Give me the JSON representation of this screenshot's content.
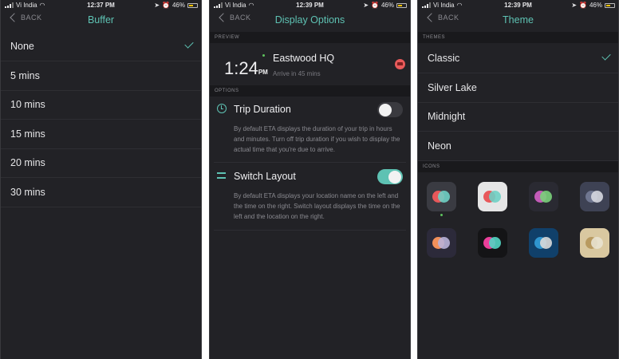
{
  "screens": [
    {
      "status": {
        "carrier": "Vi India",
        "time": "12:37 PM",
        "battery": "46%"
      },
      "nav": {
        "back": "BACK",
        "title": "Buffer"
      },
      "options": [
        "None",
        "5 mins",
        "10 mins",
        "15 mins",
        "20 mins",
        "30 mins"
      ],
      "selected": "None"
    },
    {
      "status": {
        "carrier": "Vi India",
        "time": "12:39 PM",
        "battery": "46%"
      },
      "nav": {
        "back": "BACK",
        "title": "Display Options"
      },
      "preview_header": "PREVIEW",
      "preview": {
        "time": "1:24",
        "ampm": "PM",
        "name": "Eastwood HQ",
        "subtitle": "Arrive in 45 mins"
      },
      "options_header": "OPTIONS",
      "trip_duration": {
        "title": "Trip Duration",
        "description": "By default ETA displays the duration of your trip in hours and minutes. Turn off trip duration if you wish to display the actual time that you're due to arrive.",
        "enabled": false
      },
      "switch_layout": {
        "title": "Switch Layout",
        "description": "By default ETA displays your location name on the left and the time on the right. Switch layout displays the time on the left and the location on the right.",
        "enabled": true
      }
    },
    {
      "status": {
        "carrier": "Vi India",
        "time": "12:39 PM",
        "battery": "46%"
      },
      "nav": {
        "back": "BACK",
        "title": "Theme"
      },
      "themes_header": "THEMES",
      "themes": [
        "Classic",
        "Silver Lake",
        "Midnight",
        "Neon"
      ],
      "selected": "Classic",
      "icons_header": "ICONS",
      "icons": [
        {
          "bg": "#3a3b42",
          "a": "#e8585a",
          "b": "#6fd0c4"
        },
        {
          "bg": "#e6e6e6",
          "a": "#e8585a",
          "b": "#6fd0c4"
        },
        {
          "bg": "#2a2a32",
          "a": "#c35bb8",
          "b": "#7ad07a"
        },
        {
          "bg": "#3e4254",
          "a": "#6f7690",
          "b": "#d6d8e0"
        },
        {
          "bg": "#2c2a3a",
          "a": "#f2905a",
          "b": "#b9b2d9"
        },
        {
          "bg": "#141416",
          "a": "#ea3f9a",
          "b": "#52d6c4"
        },
        {
          "bg": "#10406a",
          "a": "#2f95cf",
          "b": "#d9d9d9"
        },
        {
          "bg": "#d9c8a0",
          "a": "#b89a60",
          "b": "#e8e2d0"
        }
      ]
    }
  ]
}
